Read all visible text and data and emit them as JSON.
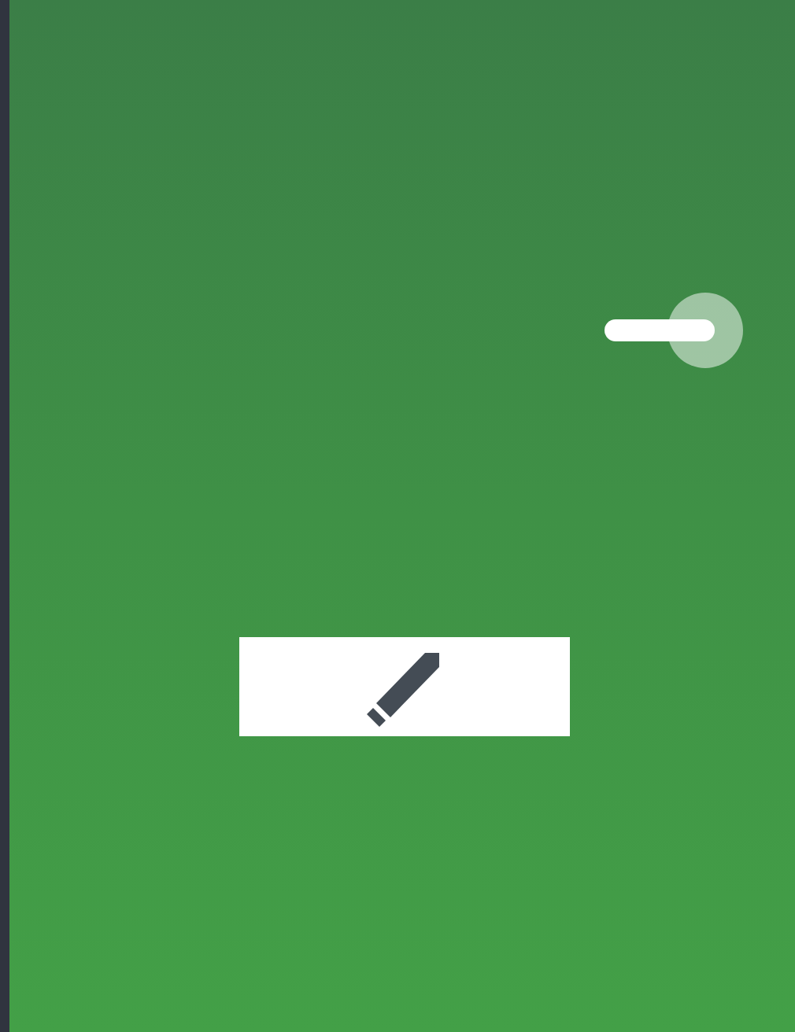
{
  "toggle": {
    "on": true
  },
  "edit_button": {
    "kind": "pencil"
  }
}
